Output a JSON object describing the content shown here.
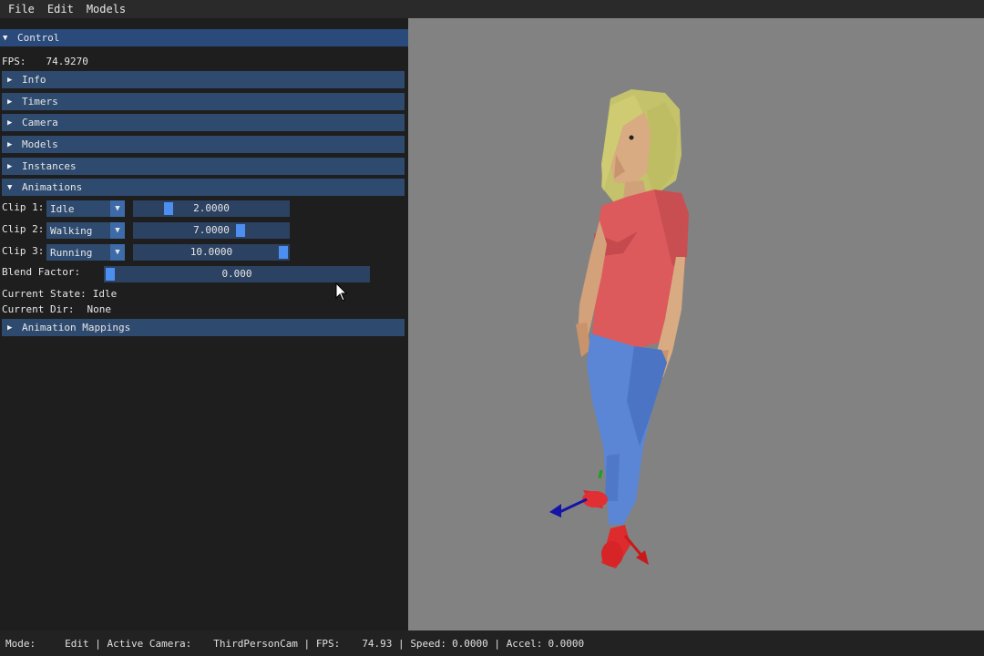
{
  "menu": {
    "items": [
      "File",
      "Edit",
      "Models"
    ]
  },
  "panel": {
    "title": "Control",
    "fps_label": "FPS:",
    "fps_value": "74.9270",
    "headers": {
      "info": "Info",
      "timers": "Timers",
      "camera": "Camera",
      "models": "Models",
      "instances": "Instances",
      "animations": "Animations",
      "animation_mappings": "Animation Mappings"
    },
    "clips": [
      {
        "label": "Clip 1:",
        "clip": "Idle",
        "value": "2.0000",
        "fraction": 0.2
      },
      {
        "label": "Clip 2:",
        "clip": "Walking",
        "value": "7.0000",
        "fraction": 0.7
      },
      {
        "label": "Clip 3:",
        "clip": "Running",
        "value": "10.0000",
        "fraction": 1.0
      }
    ],
    "blend": {
      "label": "Blend Factor:",
      "value": "0.000",
      "fraction": 0.0
    },
    "current_state_label": "Current State:",
    "current_state": "Idle",
    "current_dir_label": "Current Dir:",
    "current_dir": "None"
  },
  "status": {
    "mode_label": "Mode:",
    "mode": "Edit",
    "camera_label": "Active Camera:",
    "camera": "ThirdPersonCam",
    "fps_label": "FPS:",
    "fps": "74.93",
    "speed_label": "Speed:",
    "speed": "0.0000",
    "accel_label": "Accel:",
    "accel": "0.0000"
  },
  "colors": {
    "viewport_bg": "#828282",
    "header_bg": "#2e4a6e",
    "accent": "#4d8ff0"
  }
}
